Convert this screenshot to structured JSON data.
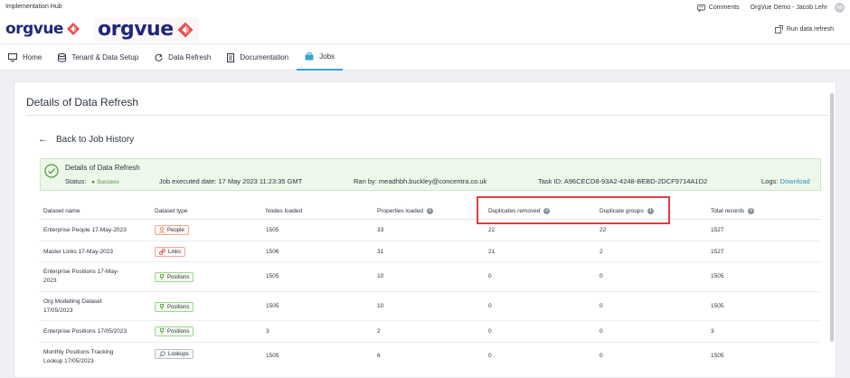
{
  "header": {
    "hub_title": "Implementation Hub",
    "logo_text": "orgvue",
    "comments_label": "Comments",
    "user_name": "OrgVue Demo - Jacob Lehr",
    "avatar_initials": "AB",
    "run_refresh_label": "Run data refresh"
  },
  "nav": {
    "items": [
      {
        "label": "Home",
        "icon": "monitor-icon"
      },
      {
        "label": "Tenant & Data Setup",
        "icon": "database-icon"
      },
      {
        "label": "Data Refresh",
        "icon": "refresh-icon"
      },
      {
        "label": "Documentation",
        "icon": "document-icon"
      },
      {
        "label": "Jobs",
        "icon": "briefcase-icon",
        "active": true
      }
    ]
  },
  "page": {
    "title": "Details of Data Refresh",
    "back_label": "Back to Job History"
  },
  "status": {
    "title": "Details of Data Refresh",
    "status_label": "Status:",
    "status_value": "Success",
    "executed": "Job executed date: 17 May 2023 11:23:35 GMT",
    "ran_by": "Ran by: meadhbh.buckley@concentra.co.uk",
    "task_id": "Task ID: A96CECD8-93A2-4248-BEBD-2DCF9714A1D2",
    "logs_label": "Logs:",
    "logs_link": "Download",
    "color": "#4a8e3a"
  },
  "table": {
    "headers": [
      "Dataset name",
      "Dataset type",
      "Nodes loaded",
      "Properties loaded",
      "Duplicates removed",
      "Duplicate groups",
      "Total records"
    ],
    "rows": [
      {
        "name1": "Enterprise People 17-May-2023",
        "name2": "",
        "type": "People",
        "nodes": "1505",
        "props": "33",
        "dup_removed": "22",
        "dup_groups": "22",
        "total": "1527"
      },
      {
        "name1": "Master Links 17-May-2023",
        "name2": "",
        "type": "Links",
        "nodes": "1506",
        "props": "31",
        "dup_removed": "21",
        "dup_groups": "2",
        "total": "1527"
      },
      {
        "name1": "Enterprise Positions 17-May-",
        "name2": "2023",
        "type": "Positions",
        "nodes": "1505",
        "props": "10",
        "dup_removed": "0",
        "dup_groups": "0",
        "total": "1505"
      },
      {
        "name1": "Org Modelling Dataset",
        "name2": "17/05/2023",
        "type": "Positions",
        "nodes": "1505",
        "props": "10",
        "dup_removed": "0",
        "dup_groups": "0",
        "total": "1505"
      },
      {
        "name1": "Enterprise Positions 17/05/2023",
        "name2": "",
        "type": "Positions",
        "nodes": "3",
        "props": "2",
        "dup_removed": "0",
        "dup_groups": "0",
        "total": "3"
      },
      {
        "name1": "Monthly Positions Tracking",
        "name2": "Lookup 17/05/2023",
        "type": "Lookups",
        "nodes": "1505",
        "props": "6",
        "dup_removed": "0",
        "dup_groups": "0",
        "total": "1505"
      }
    ]
  },
  "colors": {
    "accent": "#3aa3d3",
    "highlight": "#d9423f",
    "logo_blue": "#1e2a78",
    "logo_red": "#e8504f"
  }
}
